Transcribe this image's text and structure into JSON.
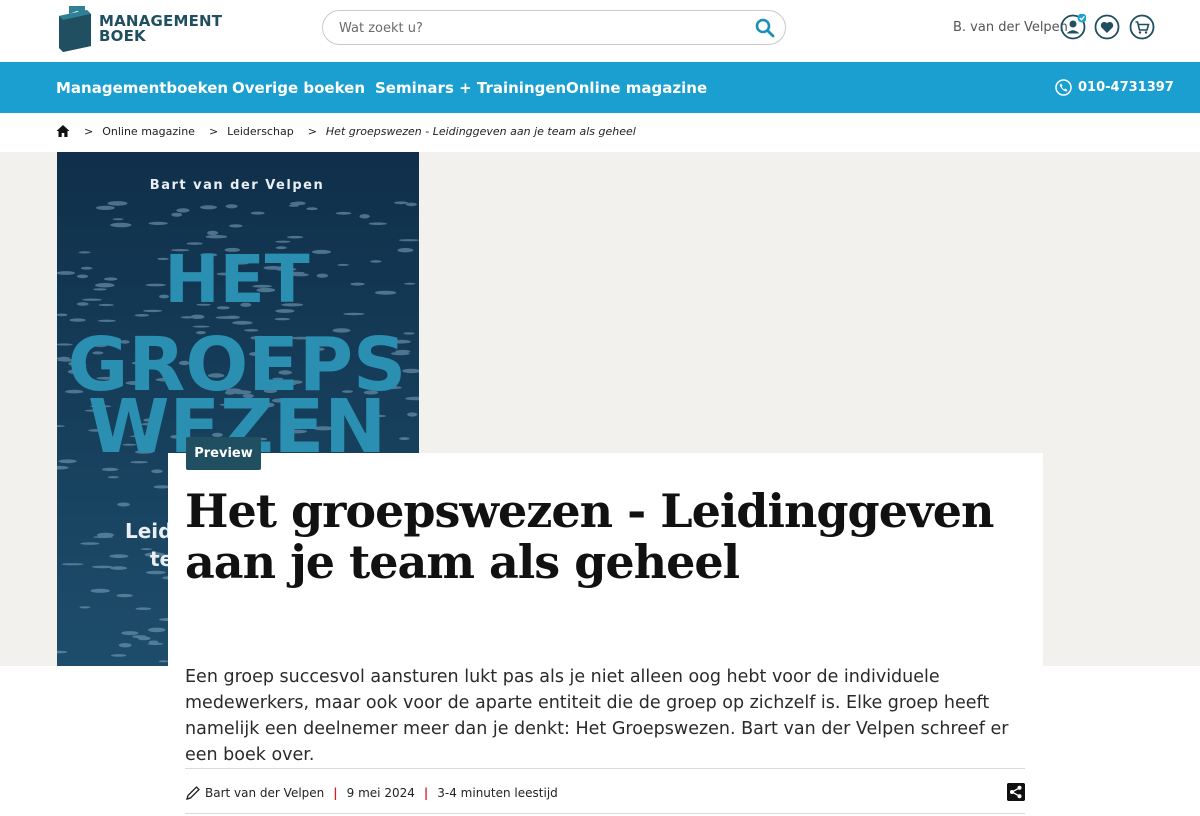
{
  "header": {
    "logo": {
      "line1": "MANAGEMENT",
      "line2": "BOEK"
    },
    "search": {
      "placeholder": "Wat zoekt u?"
    },
    "user_name": "B. van der Velpen",
    "icons": [
      "user-icon",
      "heart-icon",
      "cart-icon",
      "search-icon"
    ]
  },
  "nav": {
    "items": [
      "Managementboeken",
      "Overige boeken",
      "Seminars + Trainingen",
      "Online magazine"
    ],
    "phone": "010-4731397"
  },
  "breadcrumb": {
    "items": [
      "Online magazine",
      "Leiderschap",
      "Het groepswezen - Leidinggeven aan je team als geheel"
    ]
  },
  "cover": {
    "author": "Bart van der Velpen",
    "title_lines": [
      "HET",
      "GROEPS",
      "WEZEN"
    ],
    "subtitle_fragments": [
      "Leid",
      "te"
    ]
  },
  "article": {
    "badge": "Preview",
    "title": "Het groepswezen - Leidinggeven aan je team als geheel",
    "intro": "Een groep succesvol aansturen lukt pas als je niet alleen oog hebt voor de individuele medewerkers, maar ook voor de aparte entiteit die de groep op zichzelf is. Elke groep heeft namelijk een deelnemer meer dan je denkt: Het Groepswezen. Bart van der Velpen schreef er een boek over.",
    "author": "Bart van der Velpen",
    "date": "9 mei 2024",
    "reading_time": "3-4 minuten leestijd",
    "separator": "|"
  },
  "colors": {
    "nav": "#1a9fd0",
    "brand_dark": "#1f4f60",
    "meta_separator": "#d32027",
    "hero_bg": "#f3f1ee"
  }
}
